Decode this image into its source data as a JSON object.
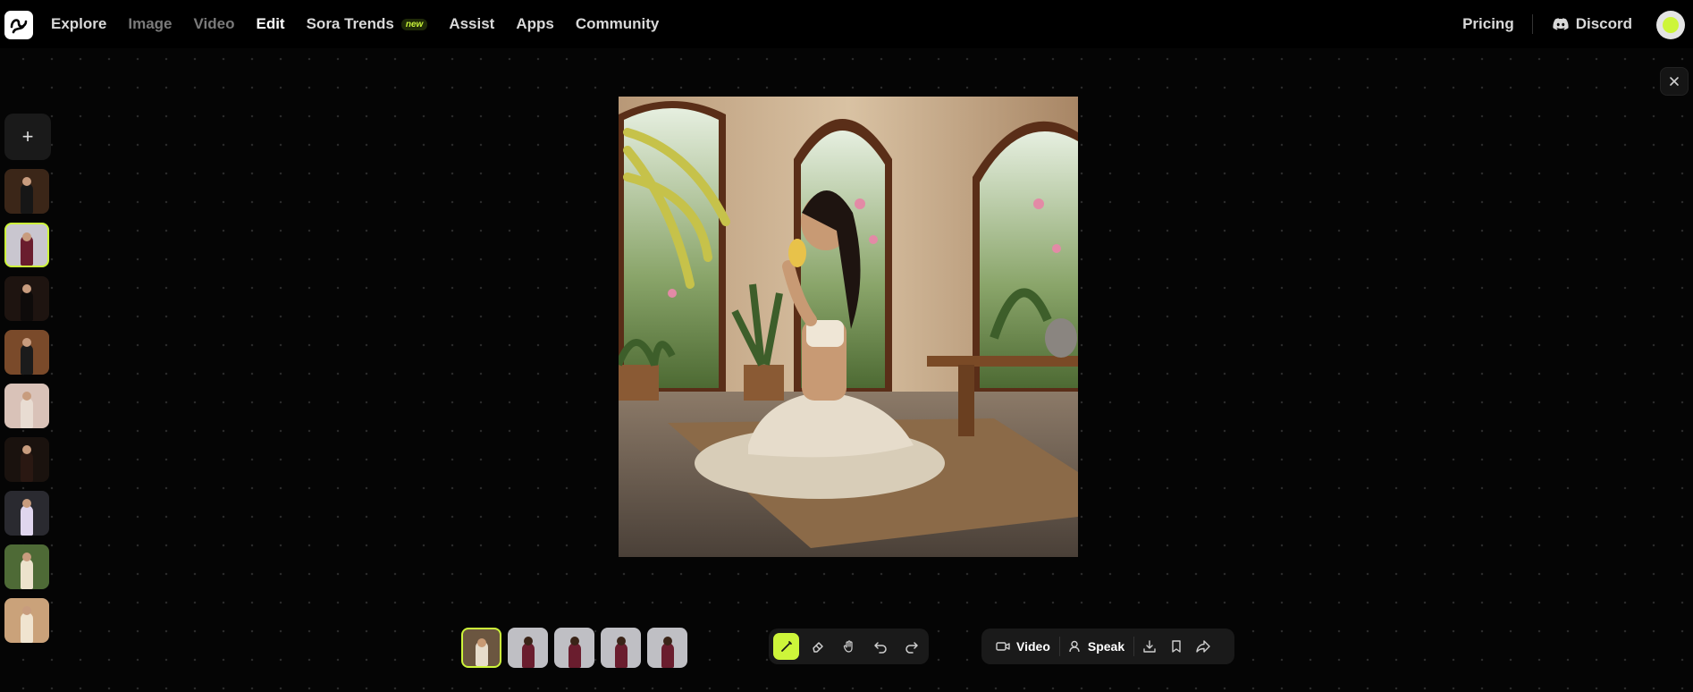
{
  "nav": {
    "items": [
      {
        "label": "Explore",
        "state": "normal"
      },
      {
        "label": "Image",
        "state": "dim"
      },
      {
        "label": "Video",
        "state": "dim"
      },
      {
        "label": "Edit",
        "state": "active"
      },
      {
        "label": "Sora Trends",
        "state": "normal",
        "badge": "new"
      },
      {
        "label": "Assist",
        "state": "normal"
      },
      {
        "label": "Apps",
        "state": "normal"
      },
      {
        "label": "Community",
        "state": "normal"
      }
    ],
    "pricing": "Pricing",
    "discord": "Discord"
  },
  "sidebar": {
    "add_label": "+",
    "thumbnails": [
      {
        "bg": "#3b2618",
        "fig": "#161616",
        "selected": false
      },
      {
        "bg": "#c9c6cf",
        "fig": "#6a1d2e",
        "selected": true
      },
      {
        "bg": "#1e1410",
        "fig": "#0e0b0a",
        "selected": false
      },
      {
        "bg": "#7a4a2a",
        "fig": "#1b1b1b",
        "selected": false
      },
      {
        "bg": "#d9c2b8",
        "fig": "#e8dcd2",
        "selected": false
      },
      {
        "bg": "#1a120e",
        "fig": "#2a1812",
        "selected": false
      },
      {
        "bg": "#2a2a30",
        "fig": "#e0d6ee",
        "selected": false
      },
      {
        "bg": "#4e6a36",
        "fig": "#ece2cc",
        "selected": false
      },
      {
        "bg": "#caa27a",
        "fig": "#f0e4d0",
        "selected": false
      }
    ]
  },
  "toolbar": {
    "video_label": "Video",
    "speak_label": "Speak"
  },
  "colors": {
    "accent": "#cdf53a",
    "panel": "#1a1a1a"
  }
}
